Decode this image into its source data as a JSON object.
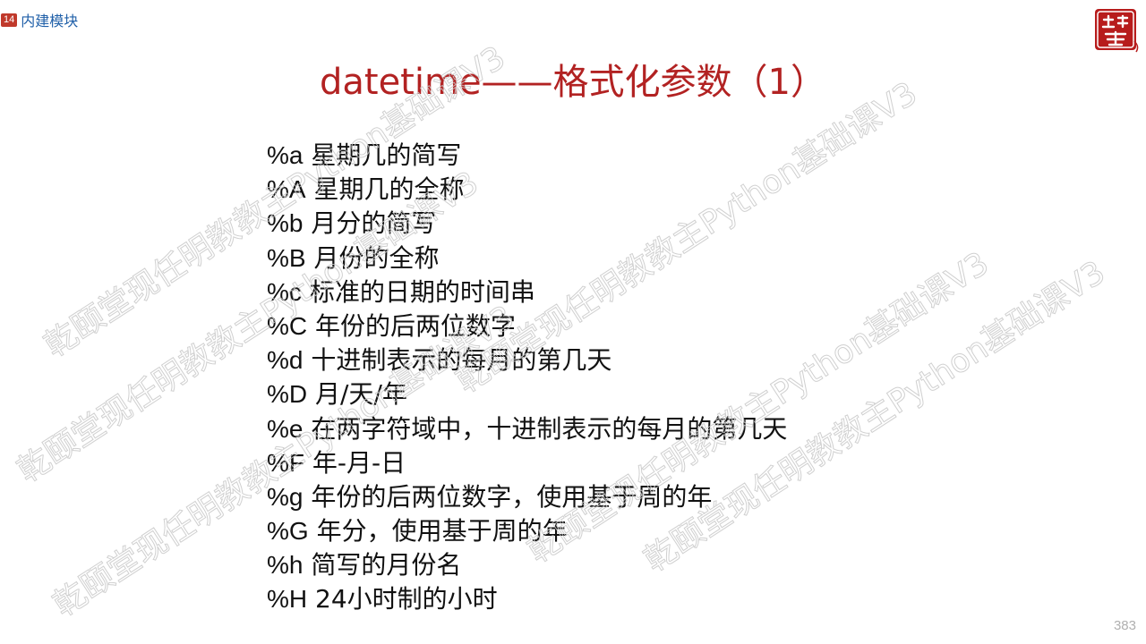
{
  "header": {
    "section_number": "14",
    "section_label": "内建模块"
  },
  "slide": {
    "title": "datetime——格式化参数（1）",
    "page_number": "383"
  },
  "logo": {
    "text": "颐乾堂",
    "icon": "seal-stamp-logo"
  },
  "items": [
    {
      "code": "%a",
      "desc": "星期几的简写"
    },
    {
      "code": "%A",
      "desc": "星期几的全称"
    },
    {
      "code": "%b",
      "desc": "月分的简写"
    },
    {
      "code": "%B",
      "desc": "月份的全称"
    },
    {
      "code": "%c",
      "desc": "标准的日期的时间串"
    },
    {
      "code": "%C",
      "desc": "年份的后两位数字"
    },
    {
      "code": "%d",
      "desc": "十进制表示的每月的第几天"
    },
    {
      "code": "%D",
      "desc": "月/天/年"
    },
    {
      "code": "%e",
      "desc": "在两字符域中，十进制表示的每月的第几天"
    },
    {
      "code": "%F",
      "desc": "年-月-日"
    },
    {
      "code": "%g",
      "desc": "年份的后两位数字，使用基于周的年"
    },
    {
      "code": "%G",
      "desc": "年分，使用基于周的年"
    },
    {
      "code": "%h",
      "desc": "简写的月份名"
    },
    {
      "code": "%H",
      "desc": "24小时制的小时"
    }
  ],
  "watermark": {
    "text": "乾颐堂现任明教教主Python基础课V3"
  },
  "colors": {
    "title": "#b22222",
    "section_badge": "#c0392b",
    "section_label": "#1f5fa8"
  }
}
